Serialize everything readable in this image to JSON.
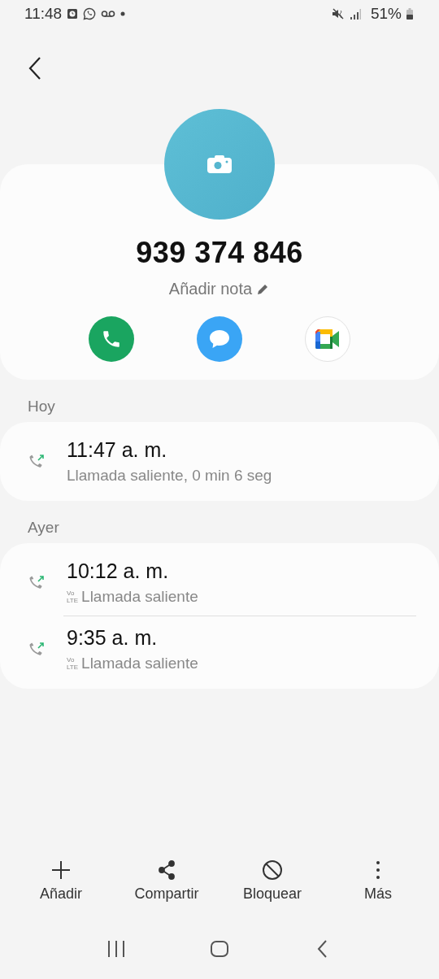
{
  "status_bar": {
    "time": "11:48",
    "battery": "51%"
  },
  "contact": {
    "number": "939 374 846",
    "note_label": "Añadir nota"
  },
  "sections": [
    {
      "label": "Hoy",
      "calls": [
        {
          "time": "11:47 a. m.",
          "detail": "Llamada saliente, 0 min 6 seg"
        }
      ]
    },
    {
      "label": "Ayer",
      "calls": [
        {
          "time": "10:12 a. m.",
          "detail": "Llamada saliente",
          "volte_badge": {
            "top": "Vo",
            "bottom": "LTE"
          }
        },
        {
          "time": "9:35 a. m.",
          "detail": "Llamada saliente",
          "volte_badge": {
            "top": "Vo",
            "bottom": "LTE"
          }
        }
      ]
    }
  ],
  "bottom_actions": [
    {
      "kind": "add",
      "label": "Añadir"
    },
    {
      "kind": "share",
      "label": "Compartir"
    },
    {
      "kind": "block",
      "label": "Bloquear"
    },
    {
      "kind": "more",
      "label": "Más"
    }
  ]
}
